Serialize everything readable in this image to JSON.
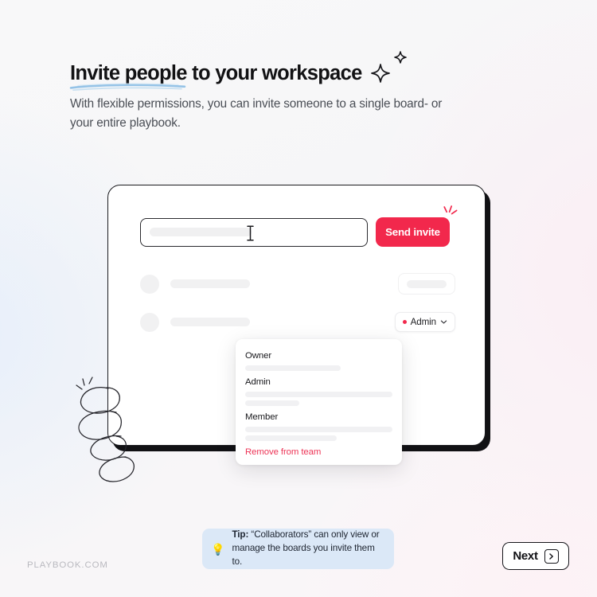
{
  "page": {
    "title": "Invite people to your workspace",
    "subtitle": "With flexible permissions, you can invite someone to a single board- or your entire playbook.",
    "watermark": "PLAYBOOK.COM"
  },
  "card": {
    "input": {
      "placeholder": "",
      "value": ""
    },
    "send_invite_label": "Send invite",
    "members": [
      {
        "name": "",
        "role_display": ""
      },
      {
        "name": "",
        "role_display": "Admin"
      }
    ],
    "role_chip": {
      "label": "Admin",
      "dot_color": "#f2284c"
    }
  },
  "role_dropdown": {
    "options": [
      {
        "label": "Owner",
        "lines": [
          65
        ]
      },
      {
        "label": "Admin",
        "lines": [
          100,
          37
        ]
      },
      {
        "label": "Member",
        "lines": [
          100,
          62
        ]
      }
    ],
    "destructive_action": "Remove from team"
  },
  "footer": {
    "tip_prefix": "Tip:",
    "tip_text": " “Collaborators” can only view or manage the boards you invite them to.",
    "next_label": "Next",
    "next_icon": "chevron-right-icon"
  },
  "colors": {
    "accent_red": "#f2284c",
    "destructive": "#ed3557",
    "tip_background": "#dbe8f7",
    "card_border": "#1b1b1f",
    "underline_blue": "#79b4e0"
  }
}
